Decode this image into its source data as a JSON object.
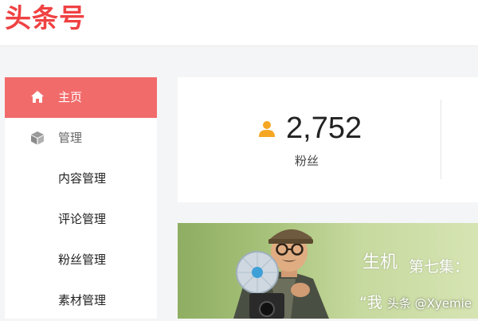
{
  "header": {
    "logo_text": "头条号"
  },
  "sidebar": {
    "items": [
      {
        "label": "主页",
        "icon": "home-icon",
        "active": true
      },
      {
        "label": "管理",
        "icon": "box-icon",
        "active": false
      },
      {
        "label": "内容管理"
      },
      {
        "label": "评论管理"
      },
      {
        "label": "粉丝管理"
      },
      {
        "label": "素材管理"
      }
    ]
  },
  "stats": {
    "followers_value": "2,752",
    "followers_label": "粉丝",
    "icon": "person-icon",
    "icon_color": "#f5a623"
  },
  "banner": {
    "title_glyphs": "生机",
    "episode": "第七集：",
    "quote": "“我 ",
    "watermark": "头条 @Xyemie"
  },
  "colors": {
    "brand": "#f04142",
    "active_nav": "#f26b6b"
  }
}
